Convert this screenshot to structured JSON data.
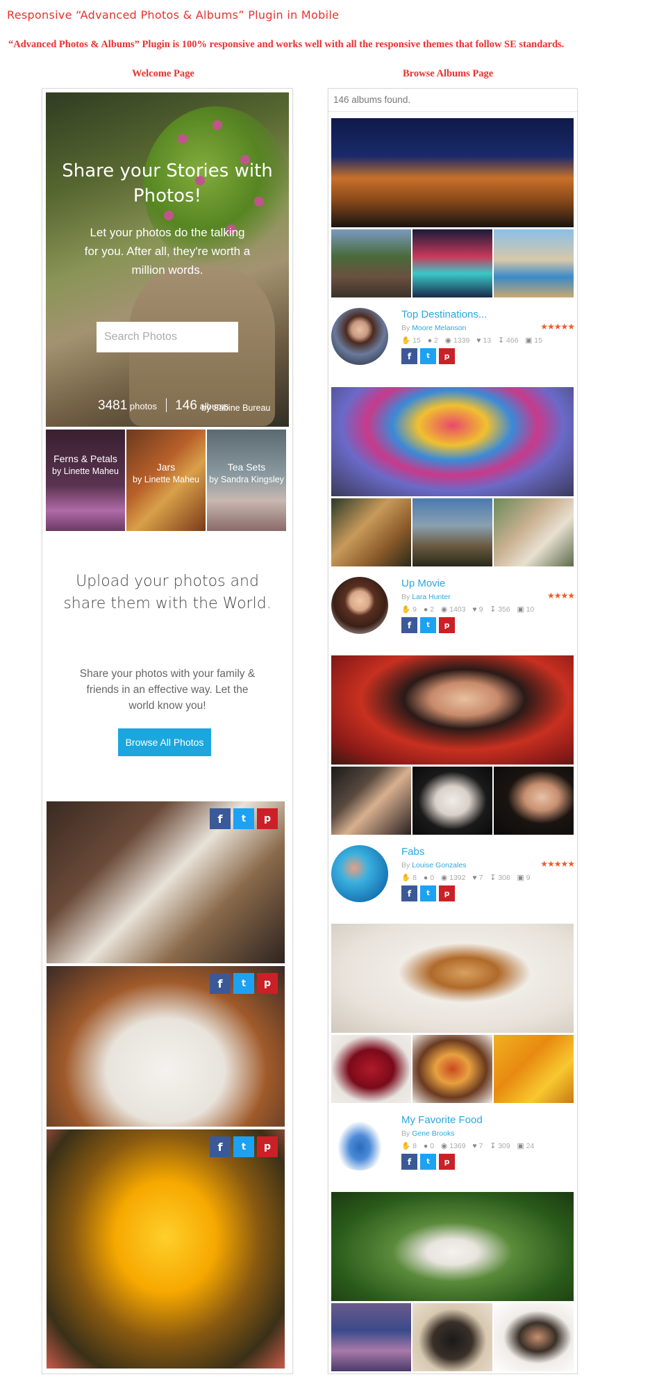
{
  "header": {
    "title": "Responsive “Advanced Photos & Albums” Plugin in Mobile",
    "subtitle": "“Advanced Photos & Albums” Plugin is 100% responsive and works well with all the responsive themes that follow SE standards.",
    "left_label": "Welcome Page",
    "right_label": "Browse Albums Page"
  },
  "welcome": {
    "hero_title": "Share your Stories with Photos!",
    "hero_desc": "Let your photos do the talking for you. After all, they're worth a million words.",
    "search_placeholder": "Search Photos",
    "photos_count": "3481",
    "photos_label": "photos",
    "albums_count": "146",
    "albums_label": "albums",
    "hero_credit": "by Sabine Bureau",
    "featured": [
      {
        "title": "Ferns & Petals",
        "by": "by Linette Maheu"
      },
      {
        "title": "Jars",
        "by": "by Linette Maheu"
      },
      {
        "title": "Tea Sets",
        "by": "by Sandra Kingsley"
      }
    ],
    "upload_heading": "Upload your photos and share them with the World.",
    "upload_text": "Share your photos with your family & friends in an effective way. Let the world know you!",
    "browse_button": "Browse All Photos"
  },
  "share": {
    "facebook": "f",
    "twitter": "t",
    "pinterest": "p"
  },
  "browse": {
    "found_text": "146 albums found.",
    "albums": [
      {
        "title": "Top Destinations...",
        "by_prefix": "By",
        "owner": "Moore Melanson",
        "stars": "★★★★★",
        "likes": "15",
        "comments": "2",
        "views": "1339",
        "favs": "13",
        "downloads": "466",
        "photos": "15"
      },
      {
        "title": "Up Movie",
        "by_prefix": "By",
        "owner": "Lara Hunter",
        "stars": "★★★★",
        "likes": "9",
        "comments": "2",
        "views": "1403",
        "favs": "9",
        "downloads": "356",
        "photos": "10"
      },
      {
        "title": "Fabs",
        "by_prefix": "By",
        "owner": "Louise Gonzales",
        "stars": "★★★★★",
        "likes": "8",
        "comments": "0",
        "views": "1392",
        "favs": "7",
        "downloads": "308",
        "photos": "9"
      },
      {
        "title": "My Favorite Food",
        "by_prefix": "By",
        "owner": "Gene Brooks",
        "stars": "",
        "likes": "8",
        "comments": "0",
        "views": "1369",
        "favs": "7",
        "downloads": "309",
        "photos": "24"
      }
    ]
  },
  "icons": {
    "like": "like-icon",
    "comment": "comment-icon",
    "view": "eye-icon",
    "fav": "heart-icon",
    "download": "download-icon",
    "photo": "image-icon"
  },
  "colors": {
    "accent": "#e8312e",
    "link": "#29a8df",
    "button": "#1ba7de",
    "star": "#f25a23",
    "facebook": "#3b5998",
    "twitter": "#1da1f2",
    "pinterest": "#cb2027"
  }
}
